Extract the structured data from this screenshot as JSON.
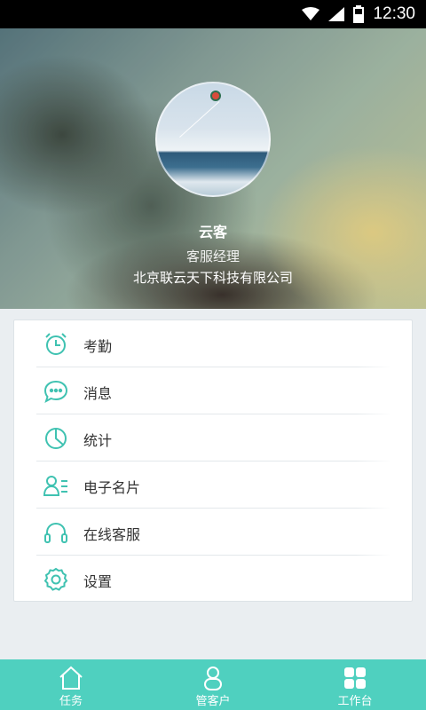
{
  "status_bar": {
    "time": "12:30"
  },
  "profile": {
    "name": "云客",
    "role": "客服经理",
    "company": "北京联云天下科技有限公司"
  },
  "menu": {
    "items": [
      {
        "label": "考勤",
        "icon": "alarm-clock-icon"
      },
      {
        "label": "消息",
        "icon": "chat-bubble-icon"
      },
      {
        "label": "统计",
        "icon": "pie-chart-icon"
      },
      {
        "label": "电子名片",
        "icon": "business-card-icon"
      },
      {
        "label": "在线客服",
        "icon": "headset-icon"
      },
      {
        "label": "设置",
        "icon": "gear-icon"
      }
    ]
  },
  "tabbar": {
    "tabs": [
      {
        "label": "任务",
        "icon": "home-icon"
      },
      {
        "label": "管客户",
        "icon": "person-icon"
      },
      {
        "label": "工作台",
        "icon": "grid-icon"
      }
    ]
  },
  "colors": {
    "accent": "#4fd0bf",
    "icon_teal": "#3fc2b1"
  }
}
